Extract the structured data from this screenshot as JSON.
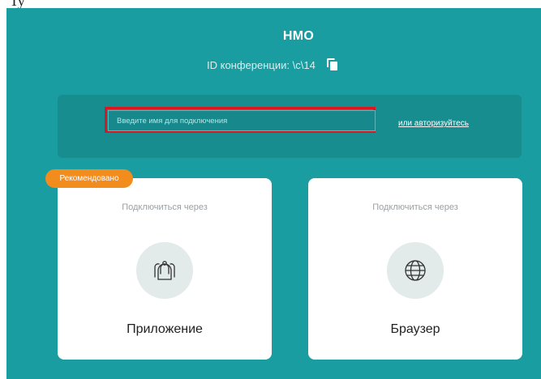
{
  "top_partial_text": "Ty",
  "conference": {
    "title": "НМО",
    "id_label": "ID конференции: \\c\\14"
  },
  "join": {
    "name_placeholder": "Введите имя для подключения",
    "name_value": "",
    "auth_link": "или авторизуйтесь"
  },
  "options": {
    "recommended_badge": "Рекомендовано",
    "app": {
      "subtitle": "Подключиться через",
      "title": "Приложение",
      "icon": "group-icon"
    },
    "browser": {
      "subtitle": "Подключиться через",
      "title": "Браузер",
      "icon": "globe-icon"
    }
  },
  "colors": {
    "background": "#1a9da0",
    "panel": "#178d90",
    "badge": "#f28c1d",
    "highlight_border": "#e0141e"
  }
}
